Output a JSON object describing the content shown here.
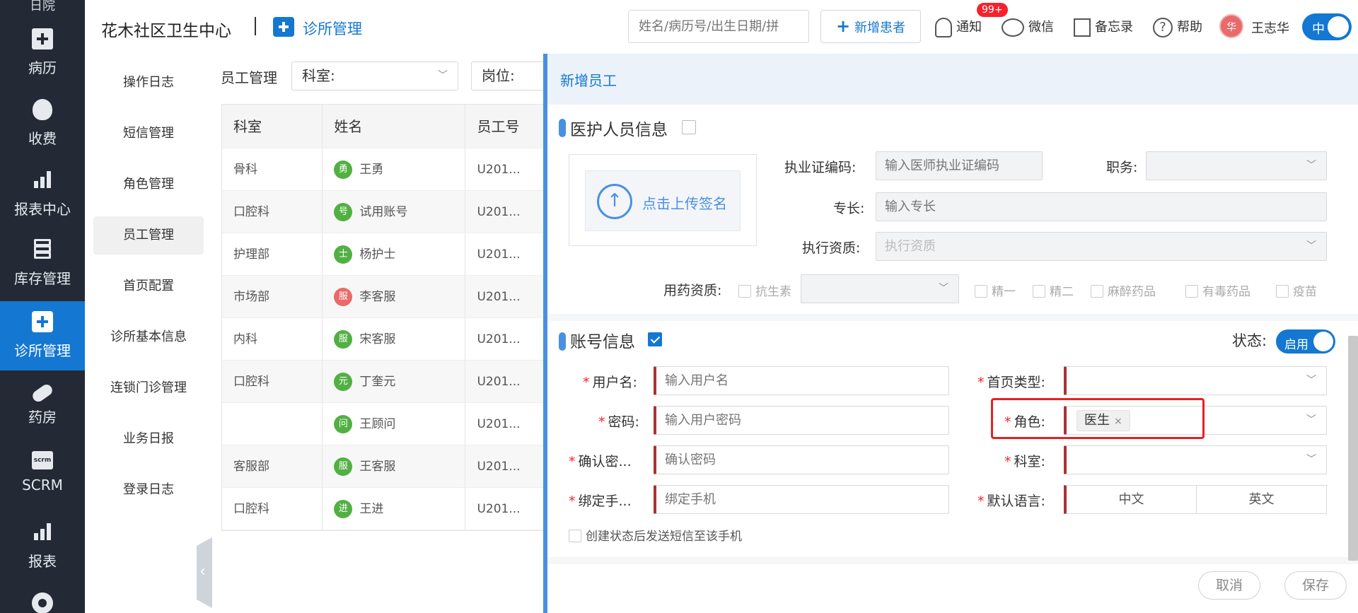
{
  "nav": {
    "top_partial": "日院",
    "items": [
      {
        "label": "病历",
        "icon": "medical-record-icon"
      },
      {
        "label": "收费",
        "icon": "money-bag-icon"
      },
      {
        "label": "报表中心",
        "icon": "bar-chart-icon"
      },
      {
        "label": "库存管理",
        "icon": "layers-icon"
      },
      {
        "label": "诊所管理",
        "icon": "clinic-icon"
      },
      {
        "label": "药房",
        "icon": "pill-icon"
      },
      {
        "label": "SCRM",
        "icon": "scrm-icon"
      },
      {
        "label": "报表",
        "icon": "bar-chart-icon"
      }
    ],
    "scrm_badge": "scrm",
    "active": "诊所管理"
  },
  "header": {
    "clinic_name": "花木社区卫生中心",
    "module": "诊所管理",
    "search_placeholder": "姓名/病历号/出生日期/拼",
    "add_patient": "新增患者",
    "notify": "通知",
    "notify_badge": "99+",
    "wechat": "微信",
    "memo": "备忘录",
    "help": "帮助",
    "help_glyph": "?",
    "avatar_char": "华",
    "user": "王志华",
    "lang": "中"
  },
  "submenu": {
    "items": [
      "操作日志",
      "短信管理",
      "角色管理",
      "员工管理",
      "首页配置",
      "诊所基本信息",
      "连锁门诊管理",
      "业务日报",
      "登录日志"
    ],
    "active": "员工管理"
  },
  "main": {
    "title": "员工管理",
    "filter_dept": "科室:",
    "filter_post": "岗位:",
    "columns": [
      "科室",
      "姓名",
      "员工号"
    ],
    "rows": [
      {
        "dept": "骨科",
        "badge": "勇",
        "badge_color": "#52b043",
        "name": "王勇",
        "id": "U201..."
      },
      {
        "dept": "口腔科",
        "badge": "号",
        "badge_color": "#52b043",
        "name": "试用账号",
        "id": "U201..."
      },
      {
        "dept": "护理部",
        "badge": "士",
        "badge_color": "#52b043",
        "name": "杨护士",
        "id": "U201..."
      },
      {
        "dept": "市场部",
        "badge": "服",
        "badge_color": "#e86a6a",
        "name": "李客服",
        "id": "U201..."
      },
      {
        "dept": "内科",
        "badge": "服",
        "badge_color": "#52b043",
        "name": "宋客服",
        "id": "U201..."
      },
      {
        "dept": "口腔科",
        "badge": "元",
        "badge_color": "#52b043",
        "name": "丁奎元",
        "id": "U201..."
      },
      {
        "dept": "",
        "badge": "问",
        "badge_color": "#52b043",
        "name": "王顾问",
        "id": "U201..."
      },
      {
        "dept": "客服部",
        "badge": "服",
        "badge_color": "#52b043",
        "name": "王客服",
        "id": "U201..."
      },
      {
        "dept": "口腔科",
        "badge": "进",
        "badge_color": "#52b043",
        "name": "王进",
        "id": "U201..."
      }
    ]
  },
  "drawer": {
    "title": "新增员工",
    "medical": {
      "section": "医护人员信息",
      "upload": "点击上传签名",
      "upload_glyph": "↑",
      "license_label": "执业证编码:",
      "license_ph": "输入医师执业证编码",
      "duty_label": "职务:",
      "specialty_label": "专长:",
      "specialty_ph": "输入专长",
      "qual_label": "执行资质:",
      "qual_ph": "执行资质",
      "drug_label": "用药资质:",
      "drug_opts": [
        "抗生素",
        "精一",
        "精二",
        "麻醉药品",
        "有毒药品",
        "疫苗"
      ]
    },
    "account": {
      "section": "账号信息",
      "status_label": "状态:",
      "status_value": "启用",
      "username_label": "用户名:",
      "username_ph": "输入用户名",
      "password_label": "密码:",
      "password_ph": "输入用户密码",
      "confirm_label": "确认密...",
      "confirm_ph": "确认密码",
      "phone_label": "绑定手...",
      "phone_ph": "绑定手机",
      "hometype_label": "首页类型:",
      "role_label": "角色:",
      "role_value": "医生",
      "dept_label": "科室:",
      "lang_label": "默认语言:",
      "lang_opts": [
        "中文",
        "英文"
      ],
      "sms_option": "创建状态后发送短信至该手机"
    },
    "cancel": "取消",
    "save": "保存"
  }
}
